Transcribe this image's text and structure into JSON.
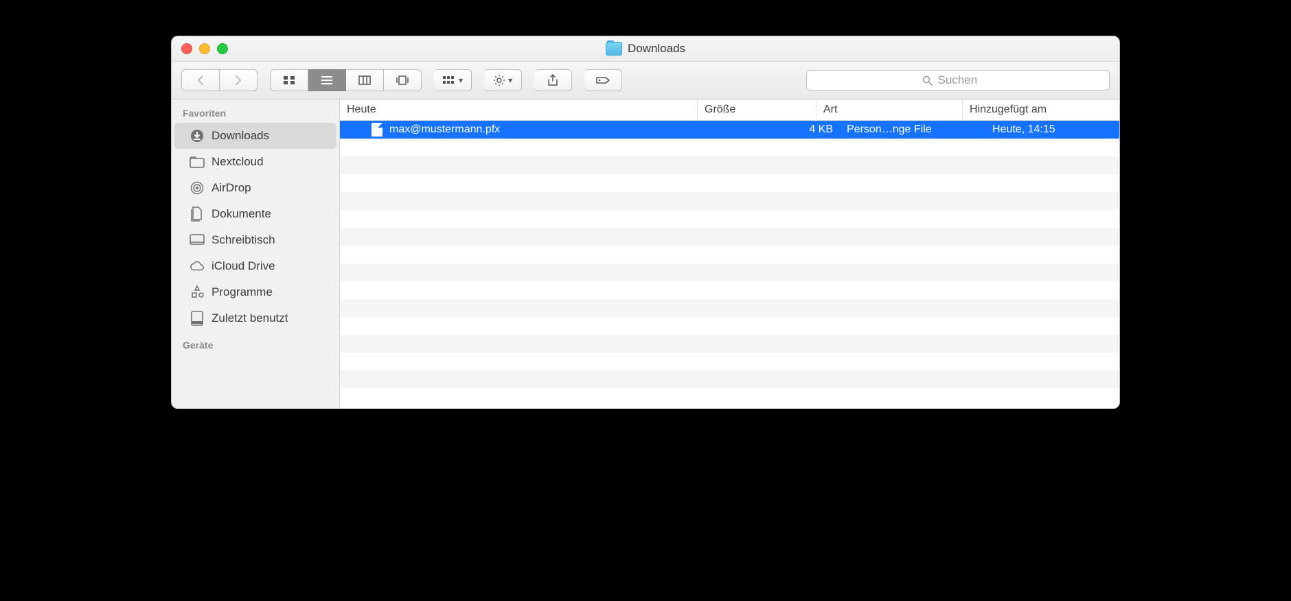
{
  "title": "Downloads",
  "search": {
    "placeholder": "Suchen"
  },
  "sidebar": {
    "headings": {
      "favorites": "Favoriten",
      "devices": "Geräte"
    },
    "items": [
      {
        "label": "Downloads",
        "icon": "download",
        "selected": true
      },
      {
        "label": "Nextcloud",
        "icon": "folder",
        "selected": false
      },
      {
        "label": "AirDrop",
        "icon": "airdrop",
        "selected": false
      },
      {
        "label": "Dokumente",
        "icon": "documents",
        "selected": false
      },
      {
        "label": "Schreibtisch",
        "icon": "desktop",
        "selected": false
      },
      {
        "label": "iCloud Drive",
        "icon": "cloud",
        "selected": false
      },
      {
        "label": "Programme",
        "icon": "apps",
        "selected": false
      },
      {
        "label": "Zuletzt benutzt",
        "icon": "recent",
        "selected": false
      }
    ]
  },
  "columns": {
    "name": "Heute",
    "size": "Größe",
    "kind": "Art",
    "date": "Hinzugefügt am"
  },
  "files": [
    {
      "name": "max@mustermann.pfx",
      "size": "4 KB",
      "kind": "Person…nge File",
      "date": "Heute, 14:15",
      "selected": true
    }
  ]
}
